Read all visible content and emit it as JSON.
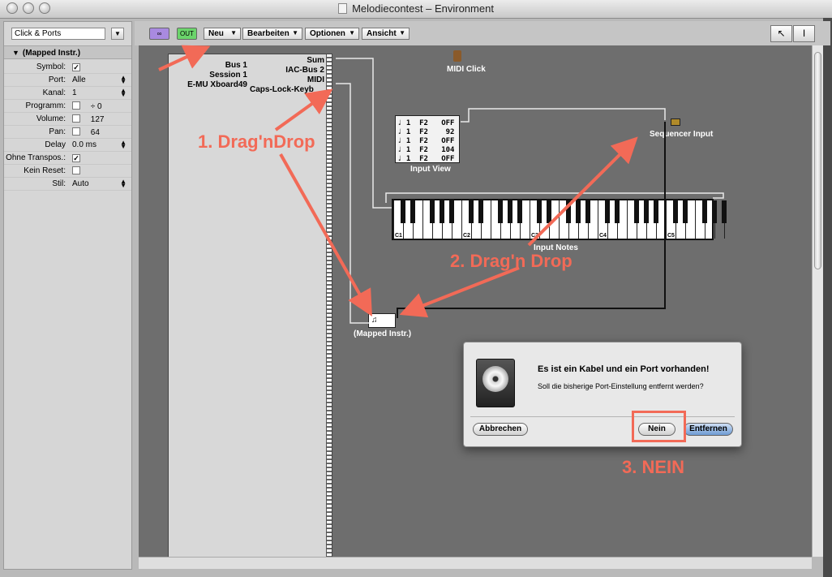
{
  "window": {
    "title": "Melodiecontest – Environment"
  },
  "colors": {
    "annotation": "#f26a57",
    "canvas": "#6e6e6e",
    "link_button": "#a98ae0",
    "midi_out_button": "#6bd46b"
  },
  "left_panel": {
    "layer_select": "Click & Ports",
    "inspector_title": "(Mapped Instr.)",
    "params": [
      {
        "label": "Symbol:",
        "value": "",
        "checkbox": true,
        "checked": true
      },
      {
        "label": "Port:",
        "value": "Alle",
        "checkbox": false
      },
      {
        "label": "Kanal:",
        "value": "1",
        "checkbox": false
      },
      {
        "label": "Programm:",
        "value": "÷      0",
        "checkbox": true,
        "checked": false
      },
      {
        "label": "Volume:",
        "value": "127",
        "checkbox": true,
        "checked": false
      },
      {
        "label": "Pan:",
        "value": "64",
        "checkbox": true,
        "checked": false
      },
      {
        "label": "Delay",
        "value": "0.0 ms",
        "checkbox": false
      },
      {
        "label": "Ohne Transpos.:",
        "value": "",
        "checkbox": true,
        "checked": true
      },
      {
        "label": "Kein Reset:",
        "value": "",
        "checkbox": true,
        "checked": false
      },
      {
        "label": "Stil:",
        "value": "Auto",
        "checkbox": false
      }
    ]
  },
  "toolbar": {
    "link_icon": "link-icon",
    "midi_out_label": "OUT",
    "menus": [
      "Neu",
      "Bearbeiten",
      "Optionen",
      "Ansicht"
    ],
    "pointer_tool": "↖",
    "text_tool": "I"
  },
  "canvas": {
    "ports_left": [
      "Bus 1",
      "Session 1",
      "E-MU Xboard49",
      "Caps-Lock-Keyboard"
    ],
    "ports_right": [
      "Sum",
      "IAC-Bus 2",
      "MIDI"
    ],
    "caps_lock_label": "Caps-Lock-Keyb",
    "midi_click_label": "MIDI Click",
    "sequencer_input_label": "Sequencer Input",
    "input_view_label": "Input View",
    "input_view_events": [
      "1  F2   OFF",
      "1  F2    92",
      "1  F2   OFF",
      "1  F2   104",
      "1  F2   OFF"
    ],
    "input_notes_label": "Input Notes",
    "octaves": [
      "C1",
      "C2",
      "C3",
      "C4",
      "C5"
    ],
    "mapped_label": "(Mapped Instr.)"
  },
  "annotations": {
    "step1": "1. Drag'nDrop",
    "step2": "2. Drag'n Drop",
    "step3": "3. NEIN"
  },
  "dialog": {
    "title": "Es ist ein Kabel und ein Port vorhanden!",
    "message": "Soll die bisherige Port-Einstellung entfernt werden?",
    "cancel": "Abbrechen",
    "no": "Nein",
    "remove": "Entfernen"
  }
}
